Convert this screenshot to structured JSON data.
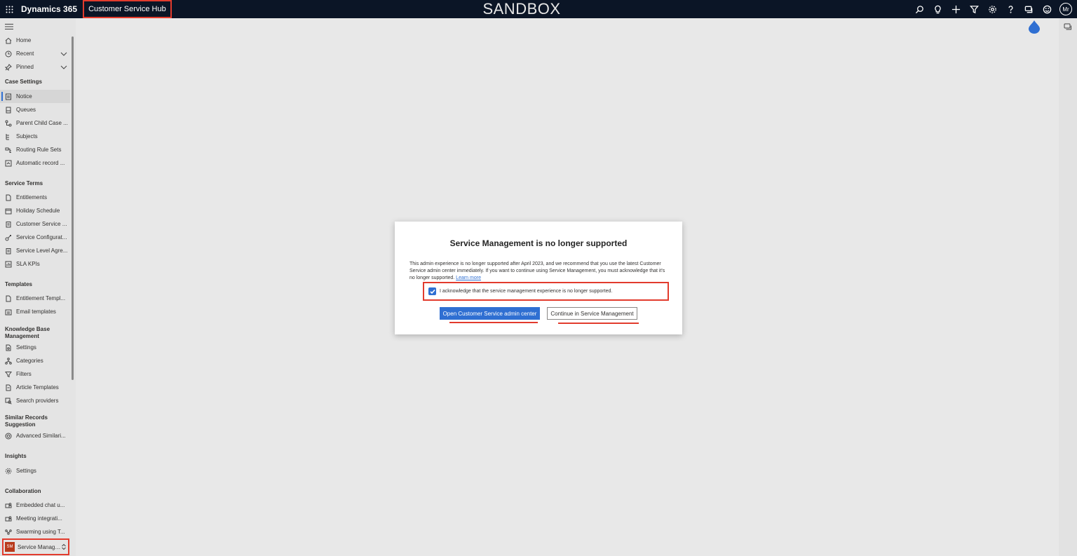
{
  "topbar": {
    "brand": "Dynamics 365",
    "app_name": "Customer Service Hub",
    "environment_banner": "SANDBOX",
    "user_initials": "Mr",
    "icons": [
      "search-icon",
      "lightbulb-icon",
      "plus-icon",
      "filter-icon",
      "gear-icon",
      "help-icon",
      "chat-icon",
      "smiley-icon"
    ]
  },
  "sidebar": {
    "top_items": [
      {
        "label": "Home",
        "icon": "home-icon"
      },
      {
        "label": "Recent",
        "icon": "clock-icon"
      },
      {
        "label": "Pinned",
        "icon": "pin-icon"
      }
    ],
    "groups": [
      {
        "header": "Case Settings",
        "items": [
          {
            "label": "Notice",
            "icon": "notice-icon",
            "active": true
          },
          {
            "label": "Queues",
            "icon": "queue-icon"
          },
          {
            "label": "Parent Child Case ...",
            "icon": "hierarchy-icon"
          },
          {
            "label": "Subjects",
            "icon": "subjects-icon"
          },
          {
            "label": "Routing Rule Sets",
            "icon": "routing-icon"
          },
          {
            "label": "Automatic record ...",
            "icon": "auto-record-icon"
          }
        ]
      },
      {
        "header": "Service Terms",
        "items": [
          {
            "label": "Entitlements",
            "icon": "document-icon"
          },
          {
            "label": "Holiday Schedule",
            "icon": "calendar-icon"
          },
          {
            "label": "Customer Service ...",
            "icon": "clipboard-icon"
          },
          {
            "label": "Service Configurat...",
            "icon": "config-icon"
          },
          {
            "label": "Service Level Agre...",
            "icon": "clipboard-icon"
          },
          {
            "label": "SLA KPIs",
            "icon": "kpi-icon"
          }
        ]
      },
      {
        "header": "Templates",
        "items": [
          {
            "label": "Entitlement Templ...",
            "icon": "document-icon"
          },
          {
            "label": "Email templates",
            "icon": "email-template-icon"
          }
        ]
      },
      {
        "header": "Knowledge Base Management",
        "items": [
          {
            "label": "Settings",
            "icon": "document-settings-icon"
          },
          {
            "label": "Categories",
            "icon": "categories-icon"
          },
          {
            "label": "Filters",
            "icon": "filter-icon"
          },
          {
            "label": "Article Templates",
            "icon": "article-template-icon"
          },
          {
            "label": "Search providers",
            "icon": "search-provider-icon"
          }
        ]
      },
      {
        "header": "Similar Records Suggestion",
        "items": [
          {
            "label": "Advanced Similari...",
            "icon": "similarity-icon"
          }
        ]
      },
      {
        "header": "Insights",
        "items": [
          {
            "label": "Settings",
            "icon": "gear-icon"
          }
        ]
      },
      {
        "header": "Collaboration",
        "items": [
          {
            "label": "Embedded chat u...",
            "icon": "teams-icon"
          },
          {
            "label": "Meeting integrati...",
            "icon": "teams-icon"
          },
          {
            "label": "Swarming using T...",
            "icon": "swarm-icon"
          }
        ]
      }
    ],
    "area_switcher": {
      "badge": "SM",
      "label": "Service Managem..."
    }
  },
  "dialog": {
    "title": "Service Management is no longer supported",
    "body": "This admin experience is no longer supported after April 2023, and we recommend that you use the latest Customer Service admin center immediately. If you want to continue using Service Management, you must acknowledge that it's no longer supported.",
    "learn_more": "Learn more",
    "acknowledge_label": "I acknowledge that the service management experience is no longer supported.",
    "acknowledge_checked": true,
    "primary_button": "Open Customer Service admin center",
    "secondary_button": "Continue in Service Management"
  },
  "colors": {
    "topbar": "#0b1526",
    "accent": "#2f6fd2",
    "highlight": "#e23b2d",
    "area_badge": "#b83a1c"
  }
}
